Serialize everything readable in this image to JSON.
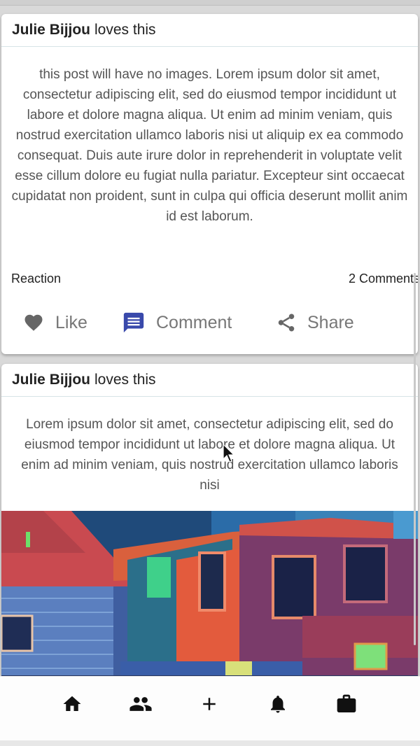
{
  "posts": [
    {
      "author": "Julie Bijjou",
      "action": "loves this",
      "text": "this post will have no images. Lorem ipsum dolor sit amet, consectetur adipiscing elit, sed do eiusmod tempor incididunt ut labore et dolore magna aliqua. Ut enim ad minim veniam, quis nostrud exercitation ullamco laboris nisi ut aliquip ex ea commodo consequat. Duis aute irure dolor in reprehenderit in voluptate velit esse cillum dolore eu fugiat nulla pariatur. Excepteur sint occaecat cupidatat non proident, sunt in culpa qui officia deserunt mollit anim id est laborum.",
      "reaction_label": "Reaction",
      "comments_label": "2 Comments",
      "actions": {
        "like": "Like",
        "comment": "Comment",
        "share": "Share"
      }
    },
    {
      "author": "Julie Bijjou",
      "action": "loves this",
      "text": "Lorem ipsum dolor sit amet, consectetur adipiscing elit, sed do eiusmod tempor incididunt ut labore et dolore magna aliqua. Ut enim ad minim veniam, quis nostrud exercitation ullamco laboris nisi",
      "image": "illustration of colorful houses"
    }
  ],
  "bottom_nav": [
    "home-icon",
    "friends-icon",
    "add-icon",
    "bell-icon",
    "briefcase-icon"
  ],
  "colors": {
    "comment_icon": "#3949ab",
    "action_text": "#777777",
    "body_text": "#555555",
    "header_divider": "#d7e3e6"
  }
}
